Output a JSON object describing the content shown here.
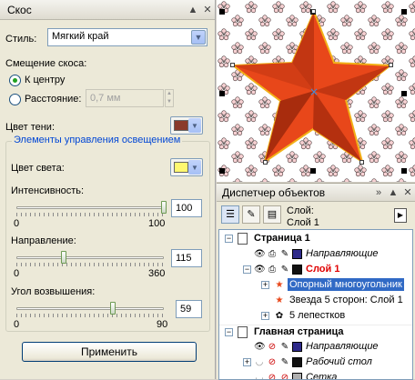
{
  "bevel": {
    "title": "Скос",
    "style_label": "Стиль:",
    "style_value": "Мягкий край",
    "offset_heading": "Смещение скоса:",
    "to_center_label": "К центру",
    "distance_label": "Расстояние:",
    "distance_value": "0,7 мм",
    "shadow_color_label": "Цвет тени:",
    "shadow_color": "#8a3a2a",
    "lighting_legend": "Элементы управления освещением",
    "light_color_label": "Цвет света:",
    "light_color": "#fff870",
    "intensity": {
      "label": "Интенсивность:",
      "min": "0",
      "max": "100",
      "value": "100",
      "level": 100,
      "range": 100
    },
    "direction": {
      "label": "Направление:",
      "min": "0",
      "max": "360",
      "value": "115",
      "level": 115,
      "range": 360
    },
    "elevation": {
      "label": "Угол возвышения:",
      "min": "0",
      "max": "90",
      "value": "59",
      "level": 59,
      "range": 90
    },
    "apply_label": "Применить"
  },
  "object_manager": {
    "title": "Диспетчер объектов",
    "layer_label_1": "Слой:",
    "layer_label_2": "Слой 1",
    "rows": [
      {
        "text": "Страница 1",
        "bold": true
      },
      {
        "text": "Направляющие",
        "italic": true,
        "color": "#2e2a8a"
      },
      {
        "text": "Слой 1",
        "bold": true,
        "red": true,
        "color": "#111111"
      },
      {
        "text": "Опорный многоугольник",
        "highlight": true
      },
      {
        "text": "Звезда  5 сторон: Слой 1"
      },
      {
        "text": "5 лепестков"
      },
      {
        "text": "Главная страница",
        "bold": true
      },
      {
        "text": "Направляющие",
        "italic": true,
        "color": "#2e2a8a"
      },
      {
        "text": "Рабочий стол",
        "italic": true,
        "color": "#111111"
      },
      {
        "text": "Сетка",
        "italic": true,
        "color": "#b0b0b0"
      }
    ]
  },
  "colors": {
    "star": "#e8471a",
    "star_dark": "#b4300f",
    "star_outline": "#f2b018",
    "accent": "#316ac5"
  }
}
